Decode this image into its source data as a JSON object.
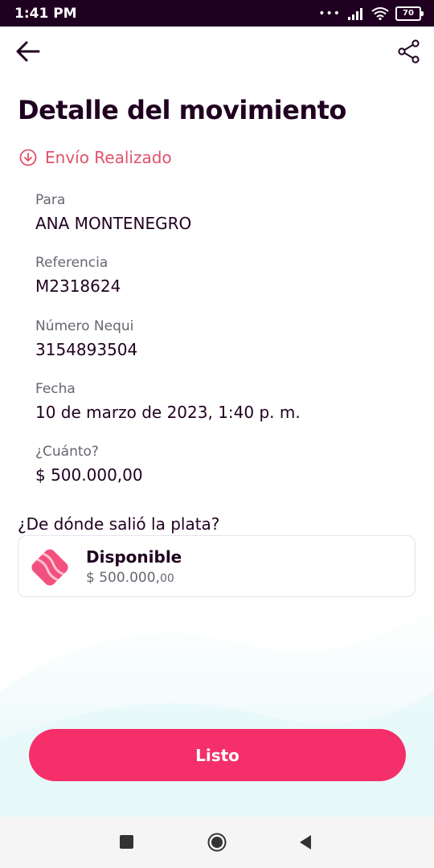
{
  "status_bar": {
    "time": "1:41 PM",
    "battery": "70"
  },
  "header": {
    "title": "Detalle del movimiento"
  },
  "transaction": {
    "status": "Envío Realizado",
    "fields": [
      {
        "label": "Para",
        "value": "ANA MONTENEGRO"
      },
      {
        "label": "Referencia",
        "value": "M2318624"
      },
      {
        "label": "Número Nequi",
        "value": "3154893504"
      },
      {
        "label": "Fecha",
        "value": "10 de marzo de 2023, 1:40 p. m."
      },
      {
        "label": "¿Cuánto?",
        "value": "$ 500.000,00"
      }
    ]
  },
  "source": {
    "question": "¿De dónde salió la plata?",
    "pocket_name": "Disponible",
    "amount_main": "$ 500.000,",
    "amount_cents": "00"
  },
  "actions": {
    "done_label": "Listo"
  },
  "colors": {
    "brand_dark": "#200020",
    "accent_pink": "#f42f6a",
    "status_red": "#e0526a"
  }
}
